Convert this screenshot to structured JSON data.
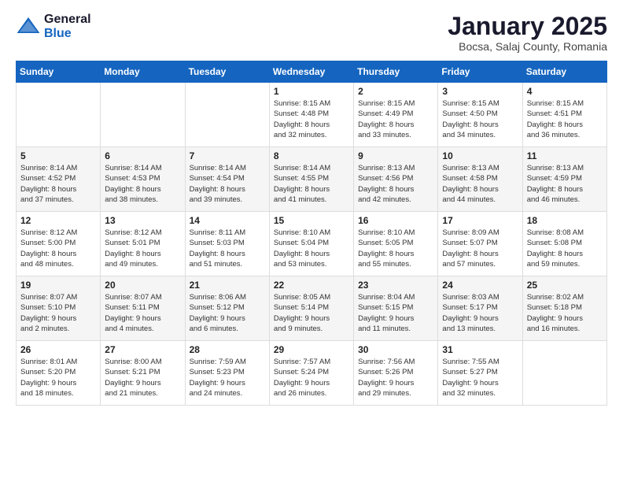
{
  "logo": {
    "general": "General",
    "blue": "Blue"
  },
  "header": {
    "month": "January 2025",
    "location": "Bocsa, Salaj County, Romania"
  },
  "weekdays": [
    "Sunday",
    "Monday",
    "Tuesday",
    "Wednesday",
    "Thursday",
    "Friday",
    "Saturday"
  ],
  "weeks": [
    [
      {
        "day": "",
        "info": ""
      },
      {
        "day": "",
        "info": ""
      },
      {
        "day": "",
        "info": ""
      },
      {
        "day": "1",
        "info": "Sunrise: 8:15 AM\nSunset: 4:48 PM\nDaylight: 8 hours\nand 32 minutes."
      },
      {
        "day": "2",
        "info": "Sunrise: 8:15 AM\nSunset: 4:49 PM\nDaylight: 8 hours\nand 33 minutes."
      },
      {
        "day": "3",
        "info": "Sunrise: 8:15 AM\nSunset: 4:50 PM\nDaylight: 8 hours\nand 34 minutes."
      },
      {
        "day": "4",
        "info": "Sunrise: 8:15 AM\nSunset: 4:51 PM\nDaylight: 8 hours\nand 36 minutes."
      }
    ],
    [
      {
        "day": "5",
        "info": "Sunrise: 8:14 AM\nSunset: 4:52 PM\nDaylight: 8 hours\nand 37 minutes."
      },
      {
        "day": "6",
        "info": "Sunrise: 8:14 AM\nSunset: 4:53 PM\nDaylight: 8 hours\nand 38 minutes."
      },
      {
        "day": "7",
        "info": "Sunrise: 8:14 AM\nSunset: 4:54 PM\nDaylight: 8 hours\nand 39 minutes."
      },
      {
        "day": "8",
        "info": "Sunrise: 8:14 AM\nSunset: 4:55 PM\nDaylight: 8 hours\nand 41 minutes."
      },
      {
        "day": "9",
        "info": "Sunrise: 8:13 AM\nSunset: 4:56 PM\nDaylight: 8 hours\nand 42 minutes."
      },
      {
        "day": "10",
        "info": "Sunrise: 8:13 AM\nSunset: 4:58 PM\nDaylight: 8 hours\nand 44 minutes."
      },
      {
        "day": "11",
        "info": "Sunrise: 8:13 AM\nSunset: 4:59 PM\nDaylight: 8 hours\nand 46 minutes."
      }
    ],
    [
      {
        "day": "12",
        "info": "Sunrise: 8:12 AM\nSunset: 5:00 PM\nDaylight: 8 hours\nand 48 minutes."
      },
      {
        "day": "13",
        "info": "Sunrise: 8:12 AM\nSunset: 5:01 PM\nDaylight: 8 hours\nand 49 minutes."
      },
      {
        "day": "14",
        "info": "Sunrise: 8:11 AM\nSunset: 5:03 PM\nDaylight: 8 hours\nand 51 minutes."
      },
      {
        "day": "15",
        "info": "Sunrise: 8:10 AM\nSunset: 5:04 PM\nDaylight: 8 hours\nand 53 minutes."
      },
      {
        "day": "16",
        "info": "Sunrise: 8:10 AM\nSunset: 5:05 PM\nDaylight: 8 hours\nand 55 minutes."
      },
      {
        "day": "17",
        "info": "Sunrise: 8:09 AM\nSunset: 5:07 PM\nDaylight: 8 hours\nand 57 minutes."
      },
      {
        "day": "18",
        "info": "Sunrise: 8:08 AM\nSunset: 5:08 PM\nDaylight: 8 hours\nand 59 minutes."
      }
    ],
    [
      {
        "day": "19",
        "info": "Sunrise: 8:07 AM\nSunset: 5:10 PM\nDaylight: 9 hours\nand 2 minutes."
      },
      {
        "day": "20",
        "info": "Sunrise: 8:07 AM\nSunset: 5:11 PM\nDaylight: 9 hours\nand 4 minutes."
      },
      {
        "day": "21",
        "info": "Sunrise: 8:06 AM\nSunset: 5:12 PM\nDaylight: 9 hours\nand 6 minutes."
      },
      {
        "day": "22",
        "info": "Sunrise: 8:05 AM\nSunset: 5:14 PM\nDaylight: 9 hours\nand 9 minutes."
      },
      {
        "day": "23",
        "info": "Sunrise: 8:04 AM\nSunset: 5:15 PM\nDaylight: 9 hours\nand 11 minutes."
      },
      {
        "day": "24",
        "info": "Sunrise: 8:03 AM\nSunset: 5:17 PM\nDaylight: 9 hours\nand 13 minutes."
      },
      {
        "day": "25",
        "info": "Sunrise: 8:02 AM\nSunset: 5:18 PM\nDaylight: 9 hours\nand 16 minutes."
      }
    ],
    [
      {
        "day": "26",
        "info": "Sunrise: 8:01 AM\nSunset: 5:20 PM\nDaylight: 9 hours\nand 18 minutes."
      },
      {
        "day": "27",
        "info": "Sunrise: 8:00 AM\nSunset: 5:21 PM\nDaylight: 9 hours\nand 21 minutes."
      },
      {
        "day": "28",
        "info": "Sunrise: 7:59 AM\nSunset: 5:23 PM\nDaylight: 9 hours\nand 24 minutes."
      },
      {
        "day": "29",
        "info": "Sunrise: 7:57 AM\nSunset: 5:24 PM\nDaylight: 9 hours\nand 26 minutes."
      },
      {
        "day": "30",
        "info": "Sunrise: 7:56 AM\nSunset: 5:26 PM\nDaylight: 9 hours\nand 29 minutes."
      },
      {
        "day": "31",
        "info": "Sunrise: 7:55 AM\nSunset: 5:27 PM\nDaylight: 9 hours\nand 32 minutes."
      },
      {
        "day": "",
        "info": ""
      }
    ]
  ]
}
